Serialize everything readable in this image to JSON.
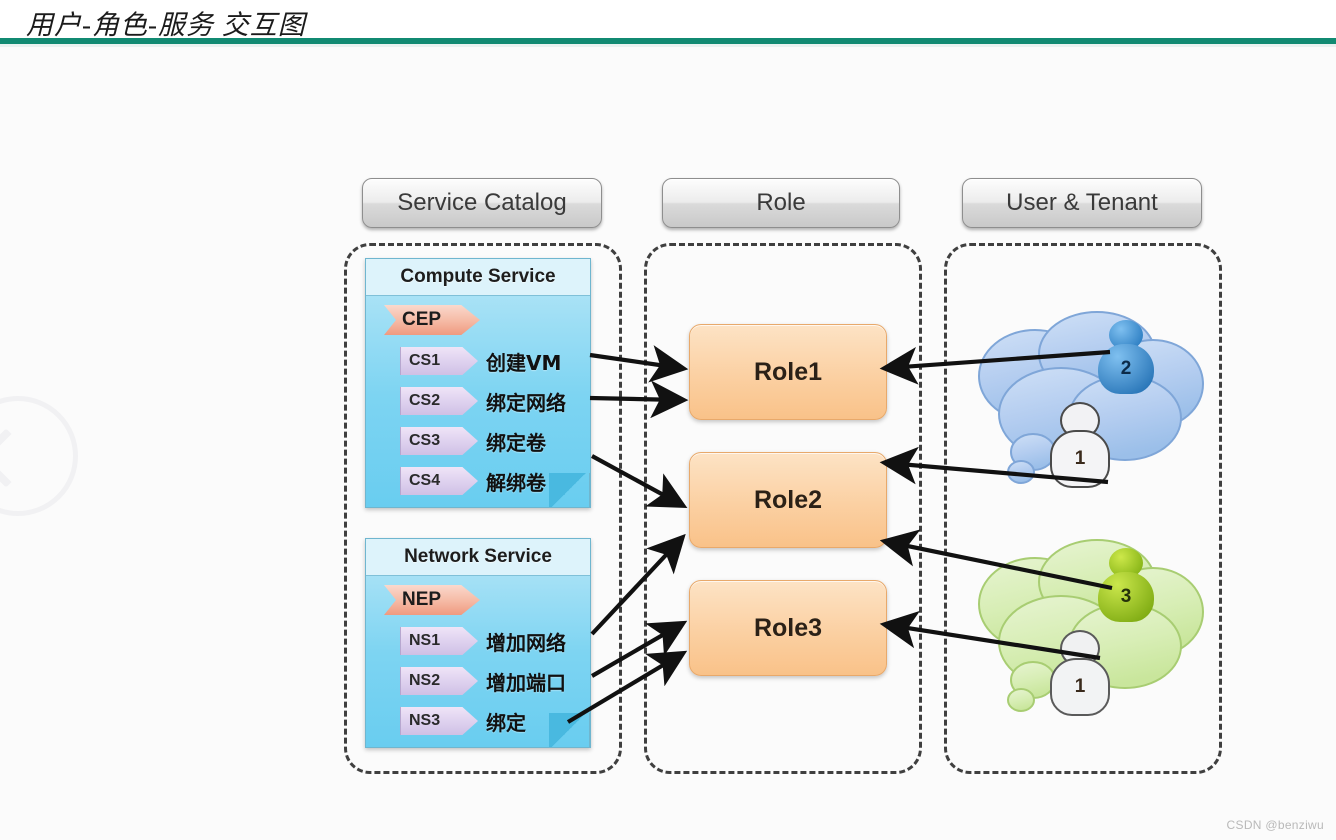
{
  "title": "用户-角色-服务 交互图",
  "watermarks": {
    "csdn": "CSDN @benziwu",
    "left_nav_icon": "back-arrow-circle-icon"
  },
  "columns": {
    "service_catalog": {
      "header": "Service Catalog"
    },
    "role": {
      "header": "Role"
    },
    "user_tenant": {
      "header": "User & Tenant"
    }
  },
  "services": [
    {
      "panel_title": "Compute Service",
      "endpoint": "CEP",
      "operations": [
        {
          "code": "CS1",
          "label": "创建VM"
        },
        {
          "code": "CS2",
          "label": "绑定网络"
        },
        {
          "code": "CS3",
          "label": "绑定卷"
        },
        {
          "code": "CS4",
          "label": "解绑卷"
        }
      ]
    },
    {
      "panel_title": "Network Service",
      "endpoint": "NEP",
      "operations": [
        {
          "code": "NS1",
          "label": "增加网络"
        },
        {
          "code": "NS2",
          "label": "增加端口"
        },
        {
          "code": "NS3",
          "label": "绑定"
        }
      ]
    }
  ],
  "roles": [
    {
      "label": "Role1"
    },
    {
      "label": "Role2"
    },
    {
      "label": "Role3"
    }
  ],
  "tenants": [
    {
      "cloud": "blue-tenant-cloud",
      "color": "#9fc4ec",
      "members": [
        {
          "badge": "2",
          "kind": "admin-user"
        },
        {
          "badge": "1",
          "kind": "normal-user"
        }
      ]
    },
    {
      "cloud": "green-tenant-cloud",
      "color": "#cfe7a4",
      "members": [
        {
          "badge": "3",
          "kind": "admin-user"
        },
        {
          "badge": "1",
          "kind": "normal-user"
        }
      ]
    }
  ],
  "colors": {
    "title_rule": "#118a72",
    "role_box": "#fbd0a2",
    "service_panel": "#7dd4f2",
    "endpoint_tag": "#f5b9a4",
    "operation_tag": "#ddd0ee"
  }
}
